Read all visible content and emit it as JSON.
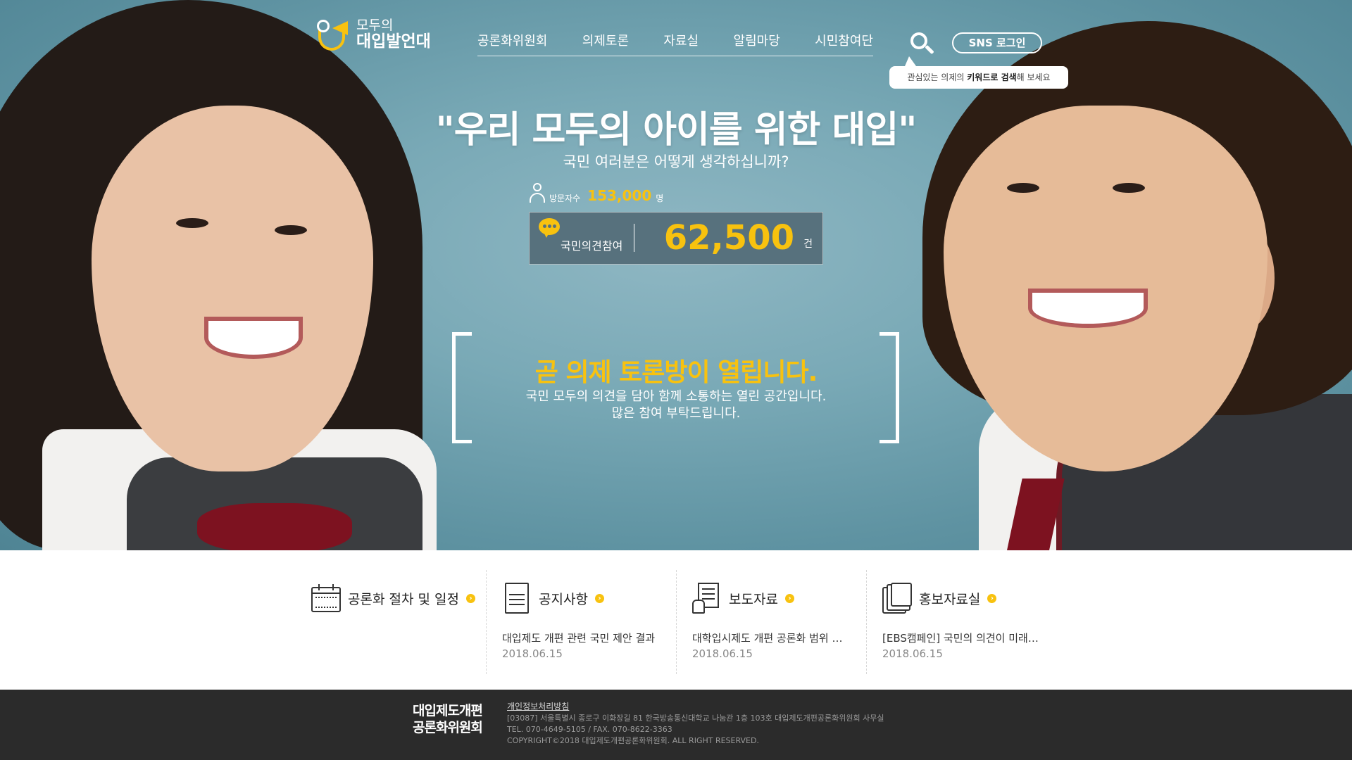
{
  "logo": {
    "line1": "모두의",
    "line2": "대입발언대"
  },
  "nav": {
    "items": [
      "공론화위원회",
      "의제토론",
      "자료실",
      "알림마당",
      "시민참여단"
    ]
  },
  "header": {
    "sns_login": "SNS 로그인"
  },
  "search_tip": {
    "pre": "관심있는 의제의 ",
    "bold": "키워드로 검색",
    "post": "해 보세요"
  },
  "hero": {
    "headline": "\"우리 모두의 아이를 위한 대입\"",
    "subhead": "국민 여러분은 어떻게 생각하십니까?"
  },
  "stats": {
    "visitor_label": "방문자수",
    "visitor_count": "153,000",
    "visitor_unit": "명",
    "opinion_label": "국민의견참여",
    "opinion_count": "62,500",
    "opinion_unit": "건"
  },
  "notice": {
    "title": "곧 의제 토론방이 열립니다.",
    "line1": "국민 모두의 의견을 담아 함께 소통하는 열린 공간입니다.",
    "line2": "많은 참여 부탁드립니다."
  },
  "boards": [
    {
      "icon": "calendar-icon",
      "title": "공론화 절차 및 일정",
      "item": "",
      "date": ""
    },
    {
      "icon": "document-icon",
      "title": "공지사항",
      "item": "대입제도 개편 관련 국민 제안 결과",
      "date": "2018.06.15"
    },
    {
      "icon": "press-icon",
      "title": "보도자료",
      "item": "대학입시제도 개편 공론화 범위 …",
      "date": "2018.06.15"
    },
    {
      "icon": "folder-icon",
      "title": "홍보자료실",
      "item": "[EBS캠페인] 국민의 의견이 미래…",
      "date": "2018.06.15"
    }
  ],
  "footer": {
    "logo_line1": "대입제도개편",
    "logo_line2": "공론화위원회",
    "privacy": "개인정보처리방침",
    "address": "[03087] 서울특별시 종로구 이화장길 81 한국방송통신대학교 나눔관 1층 103호 대입제도개편공론화위원회 사무실",
    "tel": "TEL. 070-4649-5105 / FAX. 070-8622-3363",
    "copyright": "COPYRIGHT©2018 대입제도개편공론화위원회. ALL RIGHT RESERVED."
  },
  "colors": {
    "accent": "#f8c20f",
    "footer_bg": "#2b2b2b",
    "counter_bg": "#57717d"
  }
}
